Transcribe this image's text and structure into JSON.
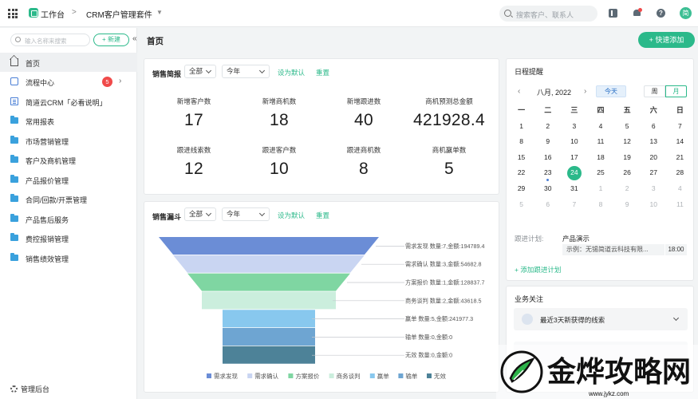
{
  "topbar": {
    "workspace": "工作台",
    "separator": ">",
    "app_name": "CRM客户管理套件",
    "search_placeholder": "搜索客户、联系人",
    "avatar_text": "简"
  },
  "sidebar": {
    "search_placeholder": "输入名称来搜索",
    "new_label": "+ 新建",
    "collapse_icon": "«",
    "items": [
      {
        "label": "首页",
        "icon": "home-icon",
        "active": true
      },
      {
        "label": "流程中心",
        "icon": "flow-icon",
        "badge": "5"
      },
      {
        "label": "简道云CRM「必看说明」",
        "icon": "document-icon"
      },
      {
        "label": "常用报表",
        "icon": "folder-icon"
      },
      {
        "label": "市场营销管理",
        "icon": "folder-icon"
      },
      {
        "label": "客户及商机管理",
        "icon": "folder-icon"
      },
      {
        "label": "产品报价管理",
        "icon": "folder-icon"
      },
      {
        "label": "合同/回款/开票管理",
        "icon": "folder-icon"
      },
      {
        "label": "产品售后服务",
        "icon": "folder-icon"
      },
      {
        "label": "费控报销管理",
        "icon": "folder-icon"
      },
      {
        "label": "销售绩效管理",
        "icon": "folder-icon"
      }
    ],
    "admin_label": "管理后台"
  },
  "main": {
    "page_title": "首页",
    "quick_add_label": "+ 快速添加"
  },
  "sales_brief": {
    "title": "销售简报",
    "scope": "全部",
    "period": "今年",
    "set_default": "设为默认",
    "reset": "重置",
    "kpis": [
      {
        "label": "新增客户数",
        "value": "17"
      },
      {
        "label": "新增商机数",
        "value": "18"
      },
      {
        "label": "新增跟进数",
        "value": "40"
      },
      {
        "label": "商机预测总金额",
        "value": "421928.4"
      },
      {
        "label": "跟进线索数",
        "value": "12"
      },
      {
        "label": "跟进客户数",
        "value": "10"
      },
      {
        "label": "跟进商机数",
        "value": "8"
      },
      {
        "label": "商机赢单数",
        "value": "5"
      }
    ]
  },
  "sales_funnel": {
    "title": "销售漏斗",
    "scope": "全部",
    "period": "今年",
    "set_default": "设为默认",
    "reset": "重置"
  },
  "chart_data": {
    "type": "funnel",
    "stages": [
      {
        "name": "需求发现",
        "count": 7,
        "amount": 194789.4,
        "label": "需求发现 数量:7,金额:194789.4",
        "color": "#6b8dd6"
      },
      {
        "name": "需求确认",
        "count": 3,
        "amount": 54682.8,
        "label": "需求确认 数量:3,金额:54682.8",
        "color": "#c9d5f2"
      },
      {
        "name": "方案报价",
        "count": 1,
        "amount": 128837.7,
        "label": "方案报价 数量:1,金额:128837.7",
        "color": "#7fd6a2"
      },
      {
        "name": "商务谈判",
        "count": 2,
        "amount": 43618.5,
        "label": "商务谈判 数量:2,金额:43618.5",
        "color": "#cbeedd"
      },
      {
        "name": "赢单",
        "count": 5,
        "amount": 241977.3,
        "label": "赢单 数量:5,金额:241977.3",
        "color": "#88c8ee"
      },
      {
        "name": "输单",
        "count": 0,
        "amount": 0,
        "label": "输单 数量:0,金额:0",
        "color": "#6ea5d2"
      },
      {
        "name": "无效",
        "count": 0,
        "amount": 0,
        "label": "无效 数量:0,金额:0",
        "color": "#4d8298"
      }
    ],
    "legend": [
      "需求发现",
      "需求确认",
      "方案报价",
      "商务谈判",
      "赢单",
      "输单",
      "无效"
    ],
    "legend_position": "bottom"
  },
  "calendar": {
    "title": "日程提醒",
    "month_label": "八月, 2022",
    "today_label": "今天",
    "week_label": "周",
    "month_button": "月",
    "weekdays": [
      "一",
      "二",
      "三",
      "四",
      "五",
      "六",
      "日"
    ],
    "weeks": [
      [
        "1",
        "2",
        "3",
        "4",
        "5",
        "6",
        "7"
      ],
      [
        "8",
        "9",
        "10",
        "11",
        "12",
        "13",
        "14"
      ],
      [
        "15",
        "16",
        "17",
        "18",
        "19",
        "20",
        "21"
      ],
      [
        "22",
        "23",
        "24",
        "25",
        "26",
        "27",
        "28"
      ],
      [
        "29",
        "30",
        "31",
        "1",
        "2",
        "3",
        "4"
      ],
      [
        "5",
        "6",
        "7",
        "8",
        "9",
        "10",
        "11"
      ]
    ],
    "selected_day": "24",
    "follow_label": "跟进计划:",
    "follow_title": "产品演示",
    "follow_example": "示例：无锡简道云科技有限...",
    "follow_time": "18:00",
    "add_follow": "+ 添加跟进计划"
  },
  "business": {
    "title": "业务关注",
    "items": [
      {
        "label": "最近3天新获得的线索",
        "icon": "filter-icon"
      }
    ]
  },
  "watermark": {
    "text": "金烨攻略网",
    "url": "www.jykz.com"
  }
}
